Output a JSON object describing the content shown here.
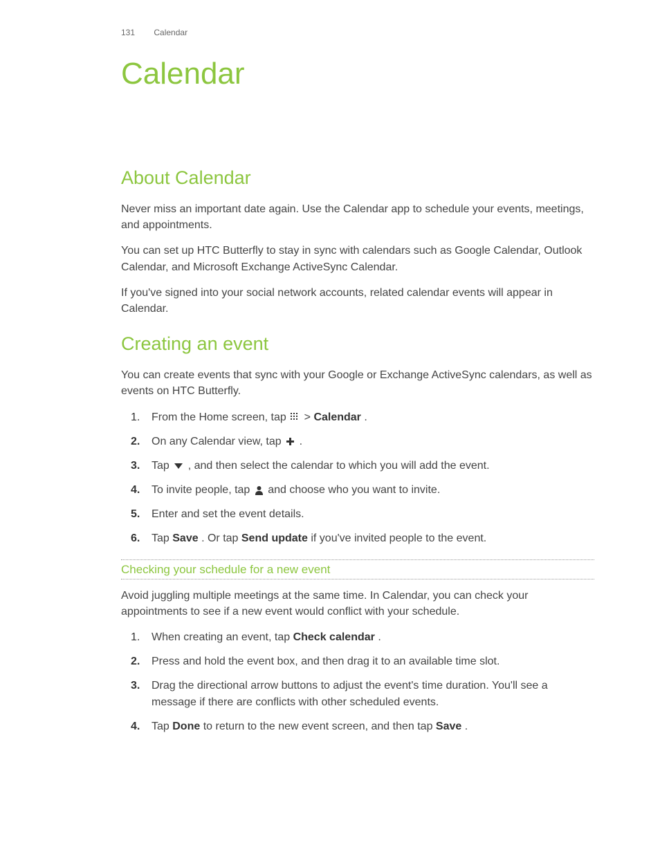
{
  "header": {
    "page_number": "131",
    "section": "Calendar"
  },
  "title": "Calendar",
  "sections": [
    {
      "heading": "About Calendar",
      "paragraphs": [
        "Never miss an important date again. Use the Calendar app to schedule your events, meetings, and appointments.",
        "You can set up HTC Butterfly to stay in sync with calendars such as Google Calendar, Outlook Calendar, and Microsoft Exchange ActiveSync Calendar.",
        "If you've signed into your social network accounts, related calendar events will appear in Calendar."
      ]
    },
    {
      "heading": "Creating an event",
      "intro": "You can create events that sync with your Google or Exchange ActiveSync calendars, as well as events on HTC Butterfly.",
      "steps": [
        {
          "pre": "From the Home screen, tap ",
          "icon": "apps-grid",
          "mid": " > ",
          "bold1": "Calendar",
          "post": "."
        },
        {
          "pre": "On any Calendar view, tap ",
          "icon": "plus",
          "post": "."
        },
        {
          "pre": "Tap ",
          "icon": "dropdown",
          "post": ", and then select the calendar to which you will add the event."
        },
        {
          "pre": "To invite people, tap ",
          "icon": "person",
          "post": " and choose who you want to invite."
        },
        {
          "text": "Enter and set the event details."
        },
        {
          "pre": "Tap ",
          "bold1": "Save",
          "mid": ". Or tap ",
          "bold2": "Send update",
          "post": " if you've invited people to the event."
        }
      ],
      "subsection": {
        "heading": "Checking your schedule for a new event",
        "intro": "Avoid juggling multiple meetings at the same time. In Calendar, you can check your appointments to see if a new event would conflict with your schedule.",
        "steps": [
          {
            "pre": "When creating an event, tap ",
            "bold1": "Check calendar",
            "post": "."
          },
          {
            "text": "Press and hold the event box, and then drag it to an available time slot."
          },
          {
            "text": "Drag the directional arrow buttons to adjust the event's time duration. You'll see a message if there are conflicts with other scheduled events."
          },
          {
            "pre": "Tap ",
            "bold1": "Done",
            "mid": " to return to the new event screen, and then tap ",
            "bold2": "Save",
            "post": "."
          }
        ]
      }
    }
  ],
  "icons": {
    "apps-grid": "apps-grid-icon",
    "plus": "plus-icon",
    "dropdown": "dropdown-icon",
    "person": "person-icon"
  }
}
